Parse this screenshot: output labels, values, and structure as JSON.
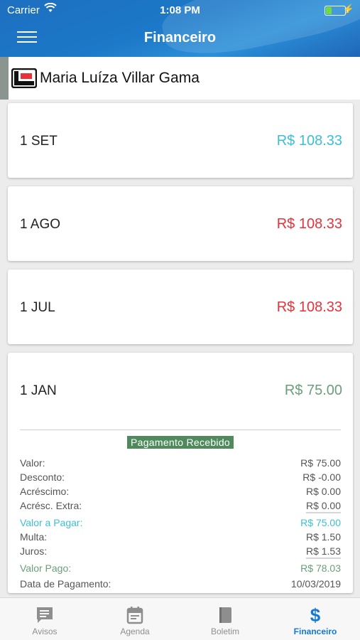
{
  "status_bar": {
    "carrier": "Carrier",
    "time": "1:08 PM",
    "battery_icon": "battery-charging-icon"
  },
  "nav": {
    "title": "Financeiro",
    "menu_icon": "hamburger-menu-icon"
  },
  "student": {
    "name": "Maria Luíza Villar Gama",
    "logo_icon": "school-logo-icon"
  },
  "colors": {
    "cyan": "#3cbfd6",
    "red": "#e8323a",
    "green": "#6b9e7a",
    "badge": "#4e8a5c",
    "active_tab": "#1479d4"
  },
  "payments": [
    {
      "month": "1 SET",
      "amount": "R$ 108.33",
      "status": "cyan"
    },
    {
      "month": "1 AGO",
      "amount": "R$ 108.33",
      "status": "red"
    },
    {
      "month": "1 JUL",
      "amount": "R$ 108.33",
      "status": "red"
    },
    {
      "month": "1 JAN",
      "amount": "R$ 75.00",
      "status": "green",
      "badge": "Pagamento Recebido",
      "details": {
        "valor": {
          "label": "Valor:",
          "value": "R$ 75.00"
        },
        "desconto": {
          "label": "Desconto:",
          "value": "R$ -0.00"
        },
        "acrescimo": {
          "label": "Acréscimo:",
          "value": "R$ 0.00"
        },
        "acresc_extra": {
          "label": "Acrésc. Extra:",
          "value": "R$ 0.00"
        },
        "valor_a_pagar": {
          "label": "Valor a Pagar:",
          "value": "R$ 75.00"
        },
        "multa": {
          "label": "Multa:",
          "value": "R$ 1.50"
        },
        "juros": {
          "label": "Juros:",
          "value": "R$ 1.53"
        },
        "valor_pago": {
          "label": "Valor Pago:",
          "value": "R$ 78.03"
        },
        "data_pagamento": {
          "label": "Data de Pagamento:",
          "value": "10/03/2019"
        }
      }
    }
  ],
  "tabs": [
    {
      "label": "Avisos",
      "icon": "message-icon"
    },
    {
      "label": "Agenda",
      "icon": "calendar-icon"
    },
    {
      "label": "Boletim",
      "icon": "book-icon"
    },
    {
      "label": "Financeiro",
      "icon": "dollar-icon",
      "active": true
    }
  ]
}
